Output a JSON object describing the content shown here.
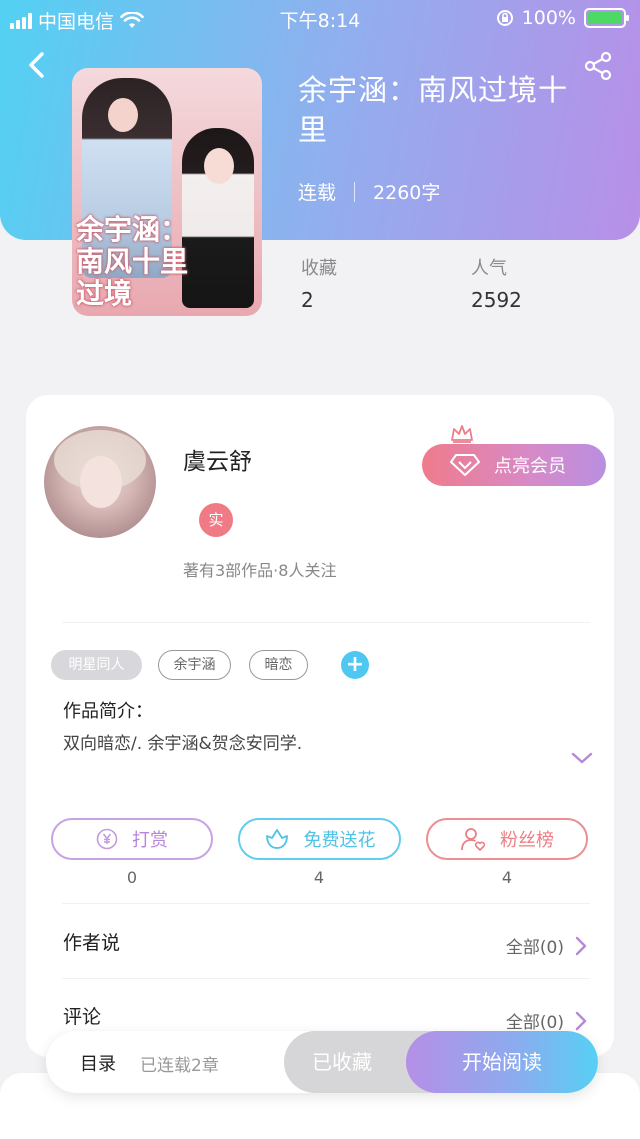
{
  "status_bar": {
    "carrier": "中国电信",
    "time": "下午8:14",
    "battery": "100%"
  },
  "book": {
    "title": "余宇涵：南风过境十里",
    "status": "连载",
    "word_count": "2260字",
    "cover_text": "余宇涵：南风十里过境",
    "collections_label": "收藏",
    "collections_value": "2",
    "popularity_label": "人气",
    "popularity_value": "2592"
  },
  "author": {
    "name": "虞云舒",
    "badge": "实",
    "stats": "著有3部作品·8人关注",
    "vip_button": "点亮会员"
  },
  "tags": [
    "明星同人",
    "余宇涵",
    "暗恋"
  ],
  "intro": {
    "label": "作品简介：",
    "text": "双向暗恋/. 余宇涵&贺念安同学."
  },
  "actions": {
    "reward_label": "打赏",
    "reward_count": "0",
    "flower_label": "免费送花",
    "flower_count": "4",
    "fans_label": "粉丝榜",
    "fans_count": "4"
  },
  "author_says": {
    "label": "作者说",
    "all": "全部(0)"
  },
  "comments": {
    "label": "评论",
    "all": "全部(0)"
  },
  "bottom_bar": {
    "toc": "目录",
    "chapters": "已连载2章",
    "collected": "已收藏",
    "start_reading": "开始阅读"
  },
  "colors": {
    "header_gradient_start": "#52d1f3",
    "header_gradient_end": "#b88fe8",
    "reward": "#b884dc",
    "flower": "#4fc2e6",
    "fans": "#ec7e85",
    "vip_start": "#f07b8b",
    "vip_end": "#b88fe0"
  },
  "icons": {
    "back": "chevron-left-icon",
    "share": "share-icon",
    "crown": "crown-icon",
    "diamond": "diamond-icon",
    "yen": "yen-icon",
    "flower": "flower-icon",
    "fans": "user-heart-icon",
    "expand": "chevron-down-icon",
    "arrow": "chevron-right-icon"
  }
}
